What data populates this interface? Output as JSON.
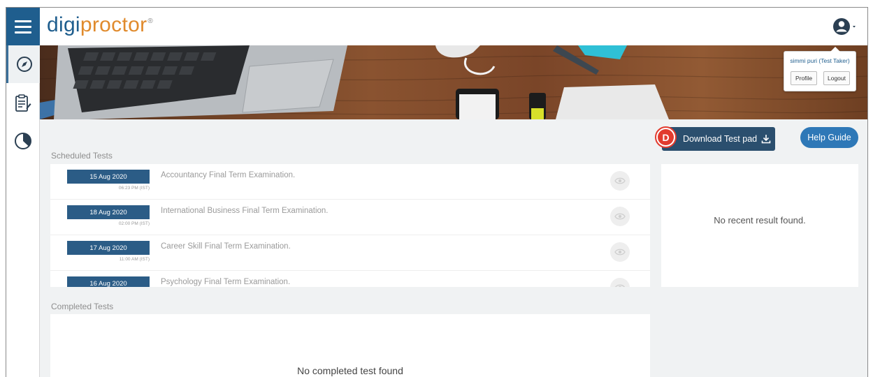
{
  "app": {
    "logo_part1": "digi",
    "logo_part2": "proctor",
    "logo_mark": "®"
  },
  "sidebar": {
    "items": [
      {
        "icon": "compass-icon"
      },
      {
        "icon": "clipboard-icon"
      },
      {
        "icon": "pie-chart-icon"
      }
    ]
  },
  "user_menu": {
    "name": "simmi puri (Test Taker)",
    "profile_label": "Profile",
    "logout_label": "Logout"
  },
  "actions": {
    "download_label": "Download Test pad",
    "marker_label": "D",
    "help_label": "Help Guide"
  },
  "scheduled": {
    "title": "Scheduled Tests",
    "rows": [
      {
        "date": "15 Aug 2020",
        "time": "06:23 PM (IST)",
        "name": "Accountancy Final Term Examination."
      },
      {
        "date": "18 Aug 2020",
        "time": "02:00 PM (IST)",
        "name": "International Business Final Term Examination."
      },
      {
        "date": "17 Aug 2020",
        "time": "11:00 AM (IST)",
        "name": "Career Skill Final Term Examination."
      },
      {
        "date": "16 Aug 2020",
        "time": "",
        "name": "Psychology Final Term Examination."
      }
    ]
  },
  "recent_result": {
    "empty_text": "No recent result found."
  },
  "completed": {
    "title": "Completed Tests",
    "empty_text": "No completed test found"
  },
  "colors": {
    "brand_blue": "#1f5e8e",
    "brand_orange": "#e08a2c",
    "badge_blue": "#2b5c86",
    "help_blue": "#2e78b7",
    "marker_red": "#e23b2e"
  }
}
